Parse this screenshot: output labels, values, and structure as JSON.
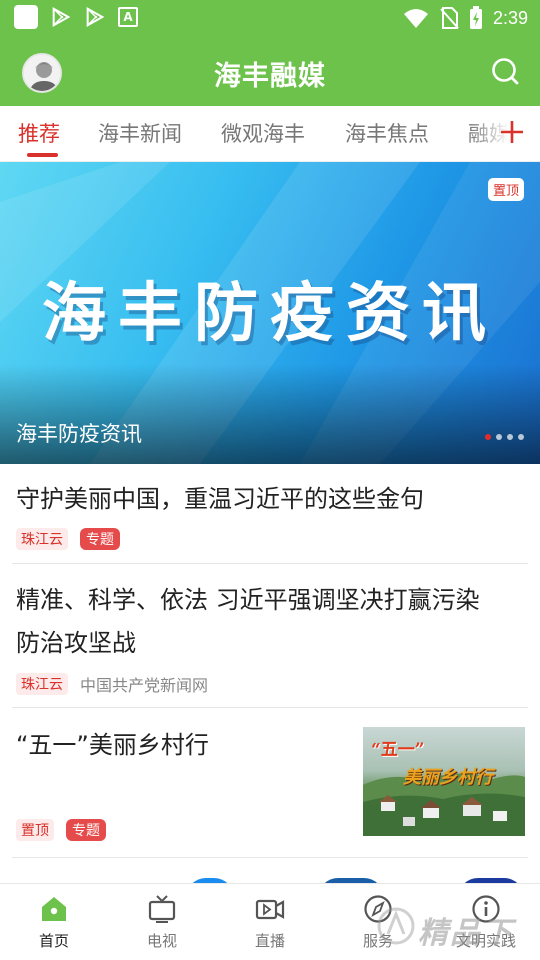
{
  "status_bar": {
    "time": "2:39",
    "icons": [
      "app-square-icon",
      "play-store-icon",
      "play-store-icon",
      "font-a-icon",
      "wifi-icon",
      "no-sim-icon",
      "battery-charging-icon"
    ]
  },
  "header": {
    "title": "海丰融媒",
    "colors": {
      "header_bg": "#6cc24a",
      "accent_red": "#d9312b"
    }
  },
  "tabs": [
    {
      "label": "推荐",
      "active": true
    },
    {
      "label": "海丰新闻"
    },
    {
      "label": "微观海丰"
    },
    {
      "label": "海丰焦点"
    },
    {
      "label": "融媒"
    }
  ],
  "banner": {
    "headline": "海丰防疫资讯",
    "caption": "海丰防疫资讯",
    "badge": "置顶",
    "slide_count": 4,
    "active_slide": 1
  },
  "news": [
    {
      "title": "守护美丽中国，重温习近平的这些金句",
      "source": "珠江云",
      "tag": "专题"
    },
    {
      "title_line1": "精准、科学、依法 习近平强调坚决打赢污染",
      "title_line2": "防治攻坚战",
      "source": "珠江云",
      "publisher": "中国共产党新闻网"
    },
    {
      "title": "“五一”美丽乡村行",
      "pin": "置顶",
      "tag": "专题",
      "thumb_text_1": "“五一”",
      "thumb_text_2": "美丽乡村行"
    }
  ],
  "bottom_nav": [
    {
      "label": "首页",
      "icon": "home-icon",
      "active": true
    },
    {
      "label": "电视",
      "icon": "tv-icon"
    },
    {
      "label": "直播",
      "icon": "live-video-icon"
    },
    {
      "label": "服务",
      "icon": "compass-icon"
    },
    {
      "label": "文明实践",
      "icon": "info-icon"
    }
  ],
  "watermark": "精品下载"
}
